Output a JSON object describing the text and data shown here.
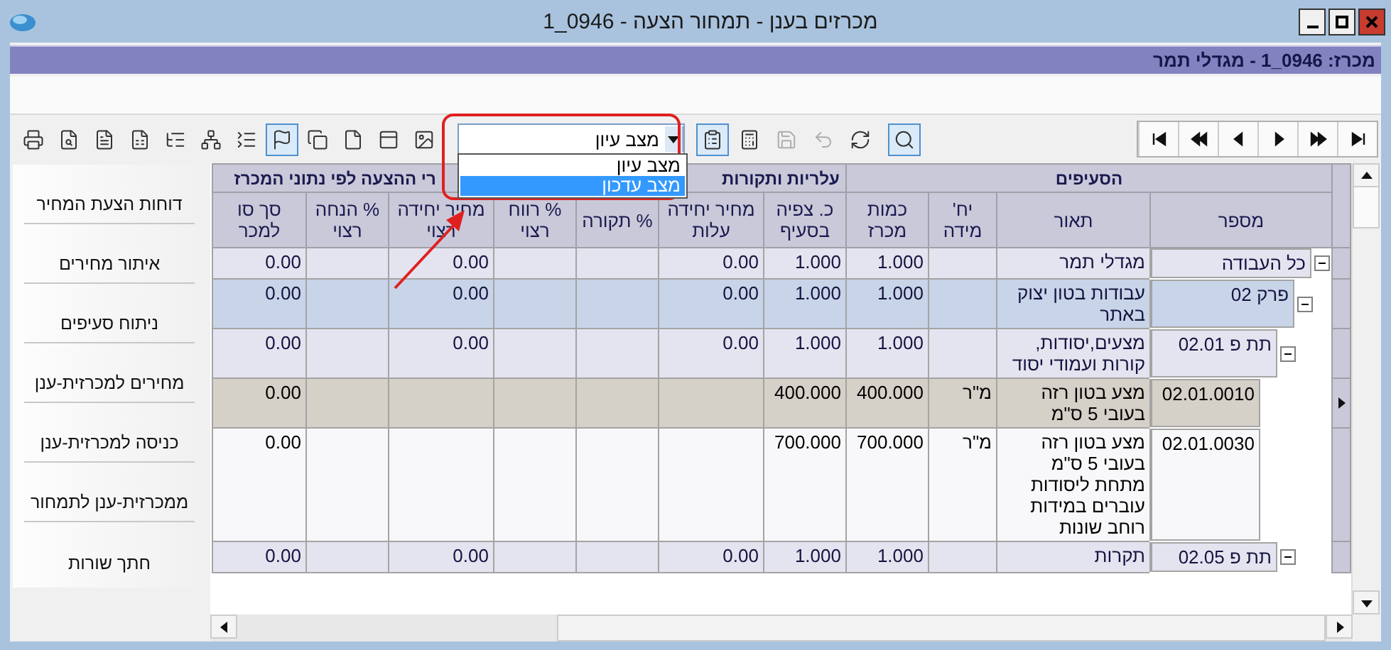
{
  "window": {
    "title": "מכרזים בענן - תמחור הצעה - 1_0946"
  },
  "header": {
    "text": "מכרז: 1_0946 - מגדלי תמר"
  },
  "toolbar": {
    "tools": [
      {
        "selected": false
      },
      {
        "selected": false
      },
      {
        "selected": false
      },
      {
        "selected": false
      },
      {
        "selected": false
      },
      {
        "selected": false
      },
      {
        "selected": false
      },
      {
        "selected": true
      },
      {
        "selected": false
      },
      {
        "selected": false
      },
      {
        "selected": false
      },
      {
        "selected": false
      }
    ],
    "mode_select": {
      "value": "מצב עיון",
      "expanded": true,
      "options": [
        {
          "label": "מצב עיון",
          "highlighted": false
        },
        {
          "label": "מצב עדכון",
          "highlighted": true
        }
      ]
    },
    "actions": [
      {
        "selected": true,
        "disabled": false
      },
      {
        "selected": false,
        "disabled": false
      },
      {
        "selected": false,
        "disabled": true
      },
      {
        "selected": false,
        "disabled": true
      },
      {
        "selected": false,
        "disabled": false
      },
      {
        "selected": true,
        "disabled": false
      }
    ]
  },
  "side_menu": [
    "דוחות הצעת המחיר",
    "איתור מחירים",
    "ניתוח סעיפים",
    "מחירים למכרזית-ענן",
    "כניסה למכרזית-ענן",
    "ממכרזית-ענן לתמחור",
    "חתך שורות"
  ],
  "table": {
    "column_groups": [
      {
        "label": "הסעיפים"
      },
      {
        "label": "עלריות ותקורות"
      },
      {
        "label": "רי ההצעה לפי נתוני המכרז"
      }
    ],
    "columns": [
      "מספר",
      "תאור",
      "יח' מידה",
      "כמות מכרז",
      "כ. צפיה בסעיף",
      "מחיר יחידה עלות",
      "% תקורה",
      "% רווח רצוי",
      "מחיר יחידה רצוי",
      "% הנחה רצוי",
      "סך סו למכר"
    ],
    "rows": [
      {
        "kind": "total",
        "selected": false,
        "expanded": true,
        "number": "כל העבודה",
        "description": "מגדלי תמר",
        "quantity": "1.000",
        "expected_quantity": "1.000",
        "unit_cost": "0.00",
        "unit_price": "0.00",
        "total": "0.00",
        "children": [
          {
            "kind": "chapter",
            "selected": false,
            "expanded": true,
            "number": "פרק 02",
            "description": "עבודות בטון יצוק באתר",
            "quantity": "1.000",
            "expected_quantity": "1.000",
            "unit_cost": "0.00",
            "unit_price": "0.00",
            "total": "0.00",
            "children": [
              {
                "kind": "section",
                "selected": false,
                "expanded": true,
                "number": "תת פ 02.01",
                "description": "מצעים,יסודות, קורות ועמודי יסוד",
                "quantity": "1.000",
                "expected_quantity": "1.000",
                "unit_cost": "0.00",
                "unit_price": "0.00",
                "total": "0.00",
                "children": [
                  {
                    "kind": "item",
                    "selected": true,
                    "number": "02.01.0010",
                    "description": "מצע בטון רזה בעובי 5 ס\"מ",
                    "unit": "מ\"ר",
                    "quantity": "400.000",
                    "expected_quantity": "400.000",
                    "total": "0.00"
                  },
                  {
                    "kind": "item",
                    "selected": false,
                    "number": "02.01.0030",
                    "description": "מצע בטון רזה בעובי 5 ס\"מ מתחת ליסודות עוברים במידות רוחב שונות",
                    "unit": "מ\"ר",
                    "quantity": "700.000",
                    "expected_quantity": "700.000",
                    "total": "0.00"
                  }
                ]
              },
              {
                "kind": "section",
                "selected": false,
                "expanded": true,
                "number": "תת פ 02.05",
                "description": "תקרות",
                "quantity": "1.000",
                "expected_quantity": "1.000",
                "unit_cost": "0.00",
                "unit_price": "0.00",
                "total": "0.00"
              }
            ]
          }
        ]
      }
    ]
  }
}
